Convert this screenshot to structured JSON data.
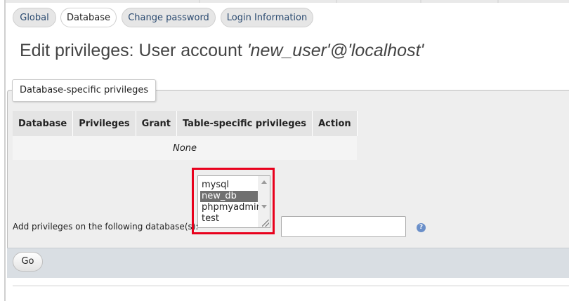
{
  "tabs": [
    "Global",
    "Database",
    "Change password",
    "Login Information"
  ],
  "active_tab": "Database",
  "title": {
    "prefix": "Edit privileges: User account ",
    "account": "'new_user'@'localhost'"
  },
  "db_privileges": {
    "legend": "Database-specific privileges",
    "columns": [
      "Database",
      "Privileges",
      "Grant",
      "Table-specific privileges",
      "Action"
    ],
    "empty_text": "None"
  },
  "add_privileges": {
    "label": "Add privileges on the following database(s):",
    "databases": [
      "mysql",
      "new_db",
      "phpmyadmin",
      "test"
    ],
    "selected": "new_db",
    "input_value": ""
  },
  "help_icon": "help-icon",
  "go_label": "Go",
  "colors": {
    "highlight": "#e8001c",
    "selected_option": "#707070"
  }
}
